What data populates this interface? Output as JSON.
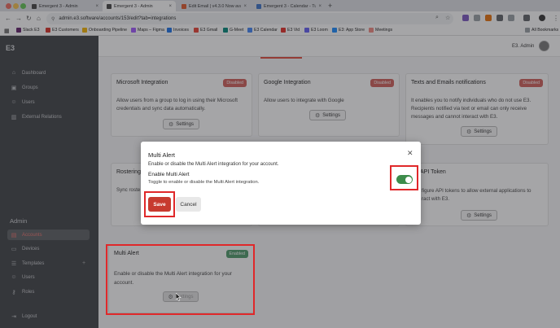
{
  "browser": {
    "tabs": [
      {
        "label": "Emergent 3 - Admin",
        "active": false
      },
      {
        "label": "Emergent 3 - Admin",
        "active": true
      },
      {
        "label": "Edit Email | v4.3.0 Now availa",
        "active": false
      },
      {
        "label": "Emergent 3 - Calendar - Tue,",
        "active": false
      }
    ],
    "url": "admin.e3.software/accounts/153/edit?tab=integrations",
    "bookmarks": [
      "Slack E3",
      "E3 Customers",
      "Onboarding Pipeline",
      "Maps – Figma",
      "Invoices",
      "E3 Gmail",
      "G-Meet",
      "E3 Calendar",
      "E3 Vid",
      "E3 Loom",
      "E3: App Store",
      "Meetings"
    ],
    "all_bookmarks": "All Bookmarks"
  },
  "sidebar": {
    "logo": "E3",
    "top_items": [
      "Dashboard",
      "Groups",
      "Users",
      "External Relations"
    ],
    "section_title": "Admin",
    "admin_items": [
      "Accounts",
      "Devices",
      "Templates",
      "Users",
      "Roles"
    ],
    "logout": "Logout",
    "plus_symbol": "+"
  },
  "header": {
    "user_name": "E3. Admin"
  },
  "cards": {
    "microsoft": {
      "title": "Microsoft Integration",
      "status": "Disabled",
      "line1": "Allow users from a group to log in using their Microsoft",
      "line2": "credentials and sync data automatically.",
      "button": "Settings"
    },
    "google": {
      "title": "Google Integration",
      "status": "Disabled",
      "line1": "Allow users to integrate with Google",
      "button": "Settings"
    },
    "texts": {
      "title": "Texts and Emails notifications",
      "status": "Disabled",
      "line1": "It enables you to notify individuals who do not use E3.",
      "line2": "Recipients notified via text or email can only receive",
      "line3": "messages and cannot interact with E3.",
      "button": "Settings"
    },
    "rostering": {
      "title_partial": "Rostering",
      "line1_partial": "Sync roste"
    },
    "api": {
      "title_partial": "API Token",
      "line1_partial": "figure API tokens to allow external applications to",
      "line2_partial": "ract with E3.",
      "button": "Settings"
    },
    "multi_alert": {
      "title": "Multi Alert",
      "status": "Enabled",
      "line1": "Enable or disable the Multi Alert integration for your",
      "line2": "account.",
      "button": "Settings"
    }
  },
  "modal": {
    "title": "Multi Alert",
    "close": "✕",
    "description": "Enable or disable the Multi Alert integration for your account.",
    "toggle_label": "Enable Multi Alert",
    "toggle_help": "Toggle to enable or disable the Multi Alert integration.",
    "toggle_on": true,
    "save": "Save",
    "cancel": "Cancel"
  },
  "colors": {
    "accent_red": "#c73a2f",
    "highlight_red": "#e0282a",
    "enabled_green": "#4e9a6a",
    "disabled_red": "#d0605b",
    "sidebar_bg": "#3f4246"
  }
}
